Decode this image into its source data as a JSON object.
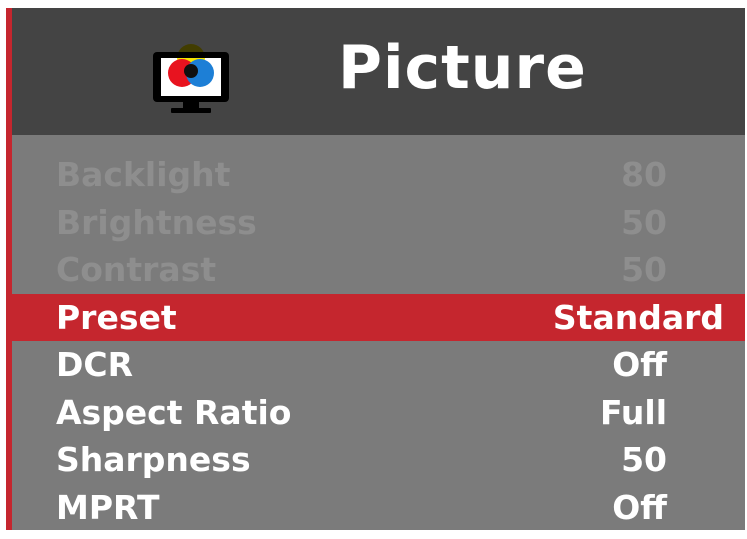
{
  "header": {
    "title": "Picture",
    "icon": "tv-color-icon"
  },
  "colors": {
    "accent": "#c5262e",
    "header_bg": "#444444",
    "panel_bg": "#7b7b7b",
    "disabled_text": "#8e8e8e",
    "text": "#ffffff"
  },
  "menu": {
    "items": [
      {
        "label": "Backlight",
        "value": "80",
        "state": "disabled"
      },
      {
        "label": "Brightness",
        "value": "50",
        "state": "disabled"
      },
      {
        "label": "Contrast",
        "value": "50",
        "state": "disabled"
      },
      {
        "label": "Preset",
        "value": "Standard",
        "state": "selected"
      },
      {
        "label": "DCR",
        "value": "Off",
        "state": "normal"
      },
      {
        "label": "Aspect Ratio",
        "value": "Full",
        "state": "normal"
      },
      {
        "label": "Sharpness",
        "value": "50",
        "state": "normal"
      },
      {
        "label": "MPRT",
        "value": "Off",
        "state": "normal"
      }
    ]
  }
}
